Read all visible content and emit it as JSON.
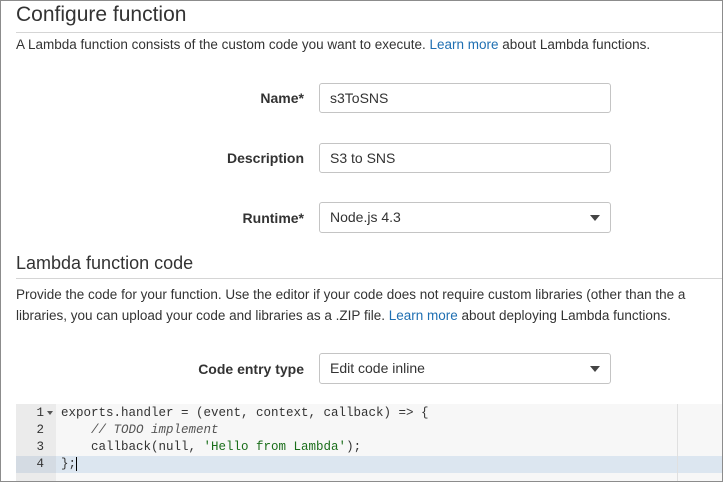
{
  "page": {
    "title": "Configure function",
    "description_prefix": "A Lambda function consists of the custom code you want to execute. ",
    "description_link": "Learn more",
    "description_suffix": " about Lambda functions."
  },
  "form": {
    "name_label": "Name*",
    "name_value": "s3ToSNS",
    "description_label": "Description",
    "description_value": "S3 to SNS",
    "runtime_label": "Runtime*",
    "runtime_value": "Node.js 4.3"
  },
  "code_section": {
    "title": "Lambda function code",
    "line1": "Provide the code for your function. Use the editor if your code does not require custom libraries (other than the a",
    "line2_prefix": "libraries, you can upload your code and libraries as a .ZIP file. ",
    "line2_link": "Learn more",
    "line2_suffix": " about deploying Lambda functions.",
    "entry_type_label": "Code entry type",
    "entry_type_value": "Edit code inline"
  },
  "editor": {
    "line_numbers": [
      "1",
      "2",
      "3",
      "4"
    ],
    "line1": "exports.handler = (event, context, callback) => {",
    "line2": "    // TODO implement",
    "line3_prefix": "    callback(null, ",
    "line3_string": "'Hello from Lambda'",
    "line3_suffix": ");",
    "line4": "};",
    "active_line": 4
  },
  "colors": {
    "link": "#1f6fb2",
    "active_line": "#dce6f0",
    "string": "#1a6e1a"
  },
  "icons": {
    "dropdown": "caret-down-icon",
    "fold": "fold-arrow-icon"
  }
}
